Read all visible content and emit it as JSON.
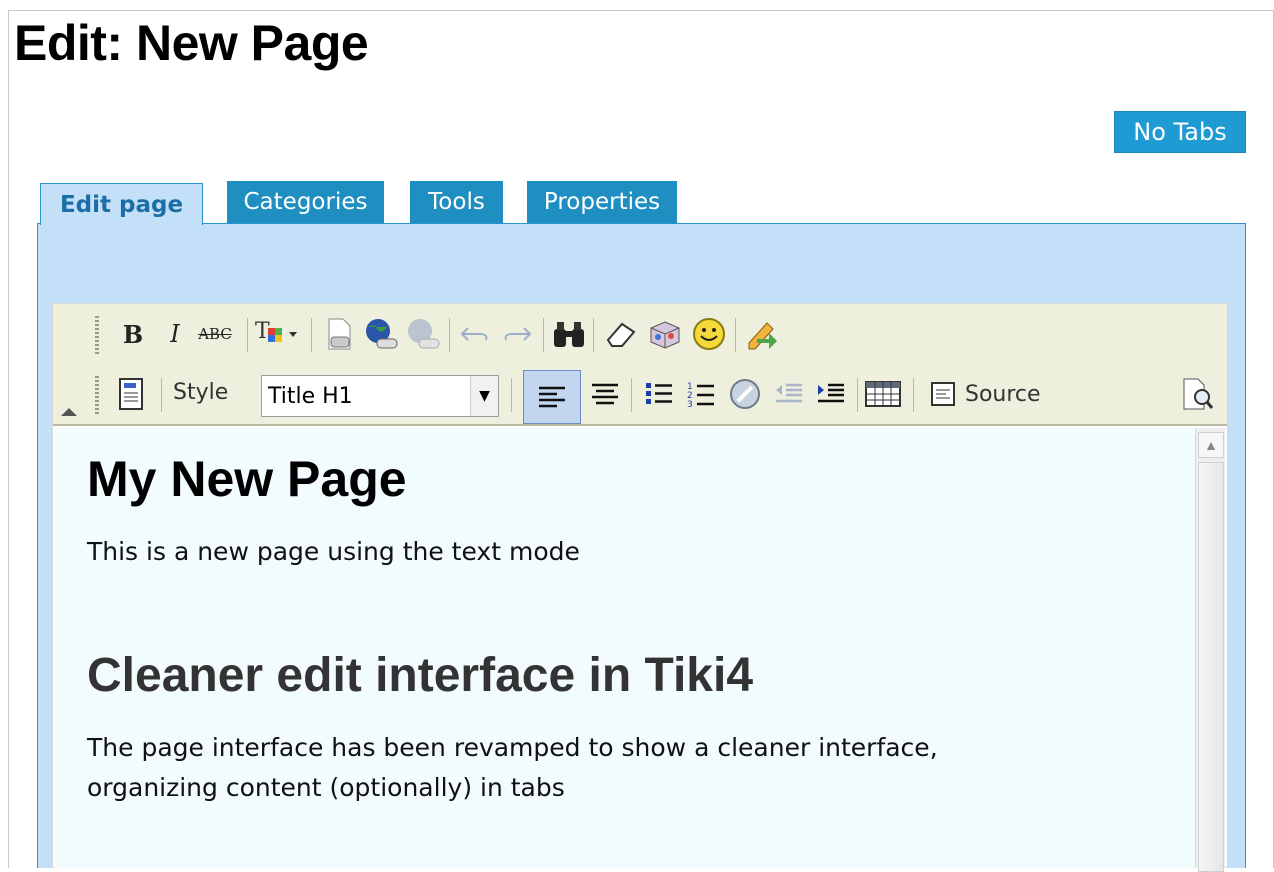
{
  "page": {
    "title": "Edit: New Page",
    "no_tabs_label": "No Tabs"
  },
  "tabs": [
    {
      "label": "Edit page",
      "active": true
    },
    {
      "label": "Categories",
      "active": false
    },
    {
      "label": "Tools",
      "active": false
    },
    {
      "label": "Properties",
      "active": false
    }
  ],
  "toolbar": {
    "row1": [
      "bold-icon",
      "italic-icon",
      "strikethrough-icon",
      "text-color-icon",
      "insert-image-icon",
      "insert-link-icon",
      "unlink-icon",
      "undo-icon",
      "redo-icon",
      "find-icon",
      "eraser-icon",
      "box-icon",
      "smiley-icon",
      "edit-pencil-icon"
    ],
    "row2": [
      "template-icon",
      "align-left-icon",
      "align-center-icon",
      "bullet-list-icon",
      "numbered-list-icon",
      "insert-compass-icon",
      "outdent-icon",
      "indent-icon",
      "table-icon",
      "source-icon",
      "preview-icon"
    ],
    "style_label": "Style",
    "style_value": "Title H1",
    "source_label": "Source"
  },
  "content": {
    "heading1": "My New Page",
    "paragraph1": "This is a new page using the text mode",
    "heading2": "Cleaner edit interface in Tiki4",
    "paragraph2_line1": "The page interface has been revamped to show a cleaner interface,",
    "paragraph2_line2": "organizing content (optionally) in tabs"
  },
  "colors": {
    "tab_bg": "#1e8fc0",
    "panel_bg": "#c4e0f8",
    "toolbar_bg": "#efefde",
    "content_bg": "#f2fbfe"
  }
}
